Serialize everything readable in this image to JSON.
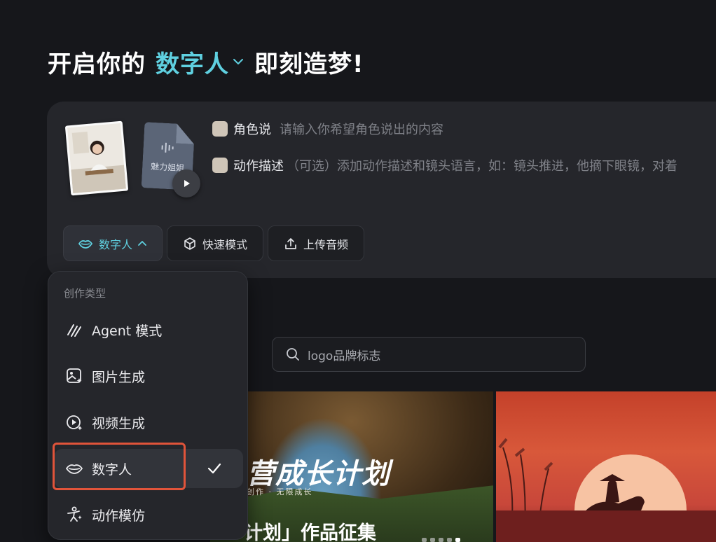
{
  "header": {
    "prefix": "开启你的",
    "mode": "数字人",
    "suffix": "即刻造梦!"
  },
  "composer": {
    "voice_name": "魅力姐姐",
    "prompts": [
      {
        "label": "角色说",
        "placeholder": "请输入你希望角色说出的内容"
      },
      {
        "label": "动作描述",
        "placeholder": "（可选）添加动作描述和镜头语言，如：镜头推进，他摘下眼镜，对着"
      }
    ],
    "chips": [
      {
        "label": "数字人",
        "icon": "lips-icon",
        "active": true
      },
      {
        "label": "快速模式",
        "icon": "cube-icon"
      },
      {
        "label": "上传音频",
        "icon": "upload-icon"
      }
    ]
  },
  "search": {
    "value": "logo品牌标志"
  },
  "gallery": {
    "card_left_heading": "营成长计划",
    "card_left_sub": "创作 · 无限成长",
    "card_left_caption": "计划」作品征集"
  },
  "dropdown": {
    "section_title": "创作类型",
    "items": [
      {
        "label": "Agent 模式",
        "icon": "agent-icon"
      },
      {
        "label": "图片生成",
        "icon": "image-gen-icon"
      },
      {
        "label": "视频生成",
        "icon": "video-gen-icon"
      },
      {
        "label": "数字人",
        "icon": "lips-icon",
        "selected": true
      },
      {
        "label": "动作模仿",
        "icon": "motion-icon"
      }
    ]
  },
  "colors": {
    "accent": "#5fd0e0",
    "highlight": "#e1543a",
    "background": "#16171b"
  }
}
